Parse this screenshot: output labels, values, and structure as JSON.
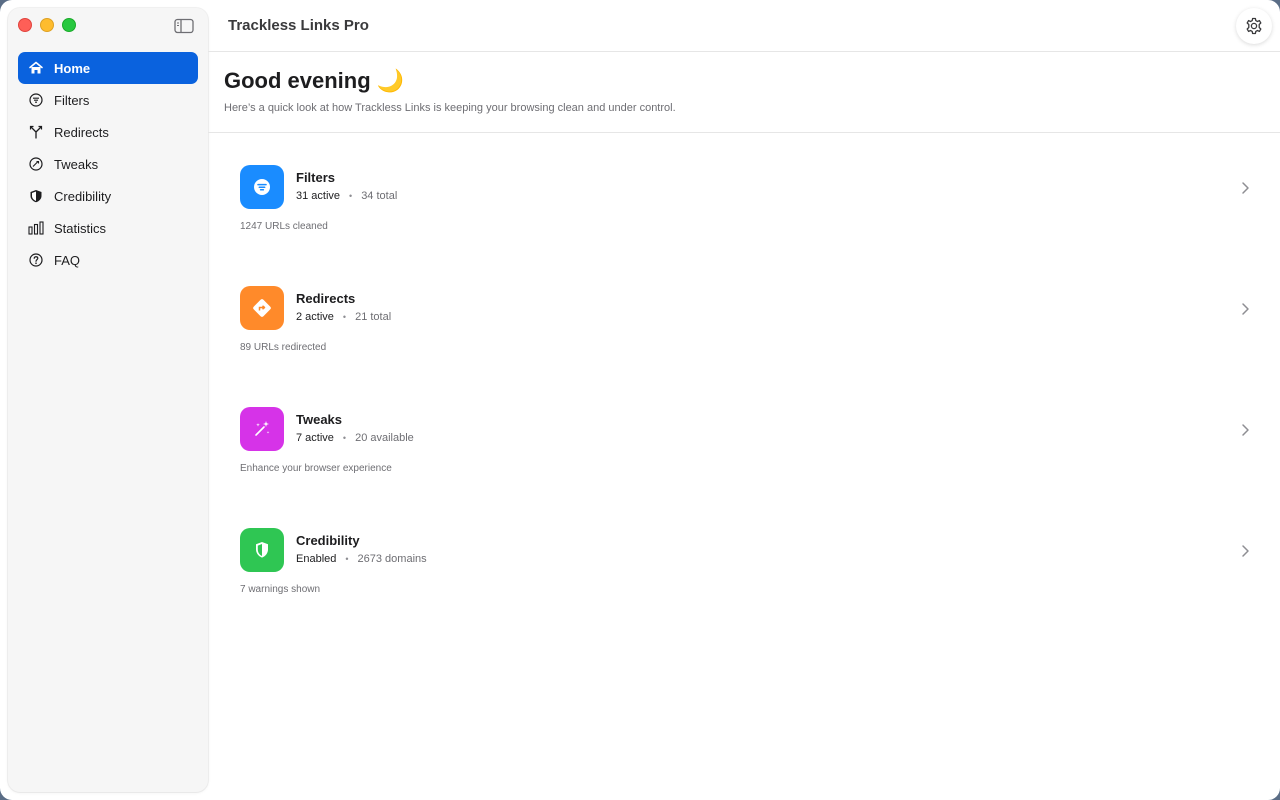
{
  "window": {
    "title": "Trackless Links Pro"
  },
  "sidebar": {
    "items": [
      {
        "label": "Home",
        "icon": "house-icon",
        "active": true
      },
      {
        "label": "Filters",
        "icon": "filter-icon",
        "active": false
      },
      {
        "label": "Redirects",
        "icon": "redirect-icon",
        "active": false
      },
      {
        "label": "Tweaks",
        "icon": "tweaks-icon",
        "active": false
      },
      {
        "label": "Credibility",
        "icon": "shield-icon",
        "active": false
      },
      {
        "label": "Statistics",
        "icon": "chart-icon",
        "active": false
      },
      {
        "label": "FAQ",
        "icon": "question-icon",
        "active": false
      }
    ]
  },
  "header": {
    "greeting": "Good evening 🌙",
    "subtitle": "Here’s a quick look at how Trackless Links is keeping your browsing clean and under control."
  },
  "cards": [
    {
      "title": "Filters",
      "primary": "31 active",
      "secondary": "34 total",
      "note": "1247 URLs cleaned",
      "color": "#1a8cff",
      "icon": "filter-icon"
    },
    {
      "title": "Redirects",
      "primary": "2 active",
      "secondary": "21 total",
      "note": "89 URLs redirected",
      "color": "#ff8a2a",
      "icon": "redirect-icon"
    },
    {
      "title": "Tweaks",
      "primary": "7 active",
      "secondary": "20 available",
      "note": "Enhance your browser experience",
      "color": "#d633e8",
      "icon": "sparkles-icon"
    },
    {
      "title": "Credibility",
      "primary": "Enabled",
      "secondary": "2673 domains",
      "note": "7 warnings shown",
      "color": "#2fc653",
      "icon": "shield-icon"
    }
  ],
  "colors": {
    "accent": "#0a62de"
  }
}
